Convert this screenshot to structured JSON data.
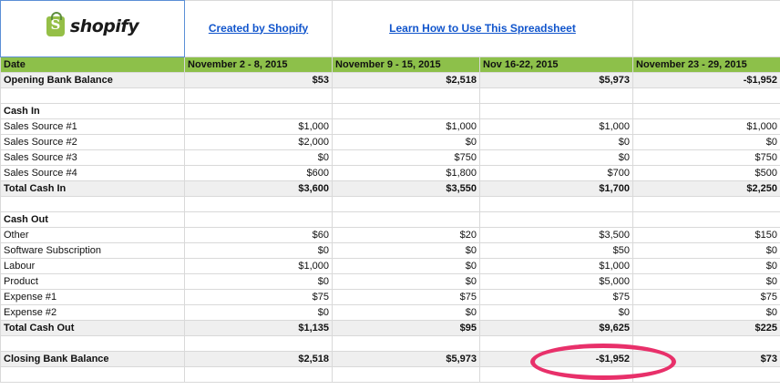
{
  "header": {
    "logo_text": "shopify",
    "logo_glyph": "S",
    "created_link": "Created by Shopify",
    "learn_link": "Learn How to Use This Spreadsheet"
  },
  "columns": [
    "Date",
    "November 2 - 8, 2015",
    "November 9 - 15, 2015",
    "Nov 16-22, 2015",
    "November 23 - 29, 2015"
  ],
  "rows": [
    {
      "type": "bold",
      "label": "Opening Bank Balance",
      "values": [
        "$53",
        "$2,518",
        "$5,973",
        "-$1,952"
      ]
    },
    {
      "type": "blank",
      "label": "",
      "values": [
        "",
        "",
        "",
        ""
      ]
    },
    {
      "type": "section",
      "label": "Cash In",
      "values": [
        "",
        "",
        "",
        ""
      ]
    },
    {
      "type": "normal",
      "label": "Sales Source #1",
      "values": [
        "$1,000",
        "$1,000",
        "$1,000",
        "$1,000"
      ]
    },
    {
      "type": "normal",
      "label": "Sales Source #2",
      "values": [
        "$2,000",
        "$0",
        "$0",
        "$0"
      ]
    },
    {
      "type": "normal",
      "label": "Sales Source #3",
      "values": [
        "$0",
        "$750",
        "$0",
        "$750"
      ]
    },
    {
      "type": "normal",
      "label": "Sales Source #4",
      "values": [
        "$600",
        "$1,800",
        "$700",
        "$500"
      ]
    },
    {
      "type": "bold",
      "label": "Total Cash In",
      "values": [
        "$3,600",
        "$3,550",
        "$1,700",
        "$2,250"
      ]
    },
    {
      "type": "blank",
      "label": "",
      "values": [
        "",
        "",
        "",
        ""
      ]
    },
    {
      "type": "section",
      "label": "Cash Out",
      "values": [
        "",
        "",
        "",
        ""
      ]
    },
    {
      "type": "normal",
      "label": "Other",
      "values": [
        "$60",
        "$20",
        "$3,500",
        "$150"
      ]
    },
    {
      "type": "normal",
      "label": "Software Subscription",
      "values": [
        "$0",
        "$0",
        "$50",
        "$0"
      ]
    },
    {
      "type": "normal",
      "label": "Labour",
      "values": [
        "$1,000",
        "$0",
        "$1,000",
        "$0"
      ]
    },
    {
      "type": "normal",
      "label": "Product",
      "values": [
        "$0",
        "$0",
        "$5,000",
        "$0"
      ]
    },
    {
      "type": "normal",
      "label": "Expense #1",
      "values": [
        "$75",
        "$75",
        "$75",
        "$75"
      ]
    },
    {
      "type": "normal",
      "label": "Expense #2",
      "values": [
        "$0",
        "$0",
        "$0",
        "$0"
      ]
    },
    {
      "type": "bold",
      "label": "Total Cash Out",
      "values": [
        "$1,135",
        "$95",
        "$9,625",
        "$225"
      ]
    },
    {
      "type": "blank",
      "label": "",
      "values": [
        "",
        "",
        "",
        ""
      ]
    },
    {
      "type": "closing",
      "label": "Closing Bank Balance",
      "values": [
        "$2,518",
        "$5,973",
        "-$1,952",
        "$73"
      ],
      "highlight_index": 2
    },
    {
      "type": "blank",
      "label": "",
      "values": [
        "",
        "",
        "",
        ""
      ]
    }
  ],
  "colors": {
    "header_green": "#8dc04a",
    "negative_highlight": "#f4c7c3",
    "annotation": "#e8306a",
    "link_blue": "#1155cc"
  }
}
